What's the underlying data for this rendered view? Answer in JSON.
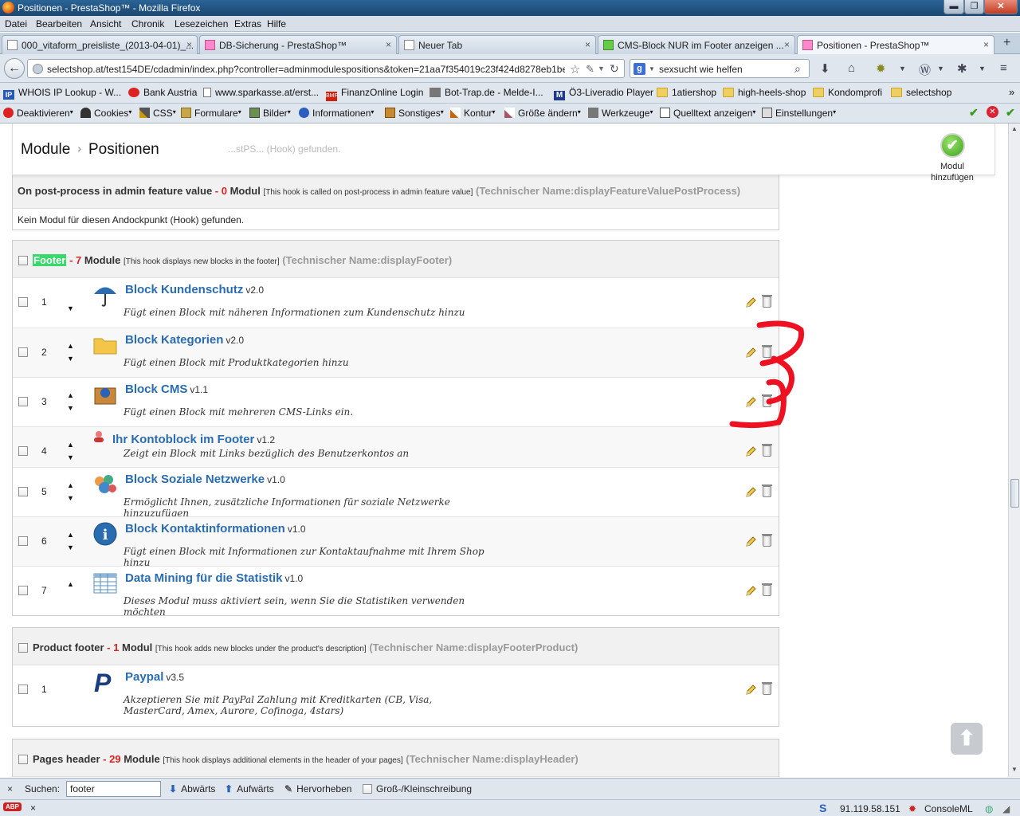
{
  "window": {
    "title": "Positionen - PrestaShop™ - Mozilla Firefox",
    "minimize": "▬",
    "maximize": "❐",
    "close": "✕"
  },
  "menu": [
    "Datei",
    "Bearbeiten",
    "Ansicht",
    "Chronik",
    "Lesezeichen",
    "Extras",
    "Hilfe"
  ],
  "tabs": [
    {
      "label": "000_vitaform_preisliste_(2013-04-01)_...",
      "close": "×"
    },
    {
      "label": "DB-Sicherung - PrestaShop™",
      "close": "×"
    },
    {
      "label": "Neuer Tab",
      "close": "×"
    },
    {
      "label": "CMS-Block NUR im Footer anzeigen ...",
      "close": "×"
    },
    {
      "label": "Positionen - PrestaShop™",
      "close": "×"
    }
  ],
  "new_tab": "+",
  "nav": {
    "url": "selectshop.at/test154DE/cdadmin/index.php?controller=adminmodulespositions&token=21aa7f354019c23f424d8278eb1be",
    "search_value": "sexsucht wie helfen",
    "back_icon": "←",
    "reload_icon": "↻",
    "star_icon": "☆",
    "search_engine_label": "g"
  },
  "bookmarks": [
    {
      "label": "WHOIS IP Lookup - W...",
      "icon": "ip-icon"
    },
    {
      "label": "Bank Austria",
      "icon": "no-entry-icon"
    },
    {
      "label": "www.sparkasse.at/erst...",
      "icon": "page-icon"
    },
    {
      "label": "FinanzOnline Login",
      "icon": "bmf-icon"
    },
    {
      "label": "Bot-Trap.de - Melde-I...",
      "icon": "bot-icon"
    },
    {
      "label": "Ö3-Liveradio Player",
      "icon": "m-icon"
    },
    {
      "label": "1atiershop",
      "icon": "folder-icon"
    },
    {
      "label": "high-heels-shop",
      "icon": "folder-icon"
    },
    {
      "label": "Kondomprofi",
      "icon": "folder-icon"
    },
    {
      "label": "selectshop",
      "icon": "folder-icon"
    }
  ],
  "bookmarks_more": "»",
  "devtools": [
    "Deaktivieren",
    "Cookies",
    "CSS",
    "Formulare",
    "Bilder",
    "Informationen",
    "Sonstiges",
    "Kontur",
    "Größe ändern",
    "Werkzeuge",
    "Quelltext anzeigen",
    "Einstellungen"
  ],
  "page": {
    "breadcrumb": [
      "Module",
      "Positionen"
    ],
    "breadcrumb_sep": "›",
    "ghost_text": "...stPS... (Hook) gefunden.",
    "add_module_label": "Modul hinzufügen",
    "add_module_icon": "✔"
  },
  "hooks": [
    {
      "title": "On post-process in admin feature value",
      "count_sep": " - ",
      "count": "0",
      "count_word": "Modul",
      "desc": "[This hook is called on post-process in admin feature value]",
      "tech": "(Technischer Name:displayFeatureValuePostProcess)",
      "empty": "Kein Modul für diesen Andockpunkt (Hook) gefunden."
    },
    {
      "title_hl": "Footer",
      "count_sep": " - ",
      "count": "7",
      "count_word": "Module",
      "desc": "[This hook displays new blocks in the footer]",
      "tech": "(Technischer Name:displayFooter)",
      "modules": [
        {
          "pos": "1",
          "name": "Block Kundenschutz",
          "ver": "v2.0",
          "desc": "Fügt einen Block mit näheren Informationen zum Kundenschutz hinzu",
          "icon": "umbrella-icon"
        },
        {
          "pos": "2",
          "name": "Block Kategorien",
          "ver": "v2.0",
          "desc": "Fügt einen Block mit Produktkategorien hinzu",
          "icon": "folder-icon"
        },
        {
          "pos": "3",
          "name": "Block CMS",
          "ver": "v1.1",
          "desc": "Fügt einen Block mit mehreren CMS-Links ein.",
          "icon": "box-icon"
        },
        {
          "pos": "4",
          "name": "Ihr Kontoblock im Footer",
          "ver": "v1.2",
          "desc": "Zeigt ein Block mit Links bezüglich des Benutzerkontos an",
          "icon": "user-icon"
        },
        {
          "pos": "5",
          "name": "Block Soziale Netzwerke",
          "ver": "v1.0",
          "desc": "Ermöglicht Ihnen, zusätzliche Informationen für soziale Netzwerke hinzuzufügen",
          "icon": "social-icon"
        },
        {
          "pos": "6",
          "name": "Block Kontaktinformationen",
          "ver": "v1.0",
          "desc": "Fügt einen Block mit Informationen zur Kontaktaufnahme mit Ihrem Shop hinzu",
          "icon": "info-icon"
        },
        {
          "pos": "7",
          "name": "Data Mining für die Statistik",
          "ver": "v1.0",
          "desc": "Dieses Modul muss aktiviert sein, wenn Sie die Statistiken verwenden möchten",
          "icon": "table-icon"
        }
      ]
    },
    {
      "title": "Product footer",
      "count_sep": " - ",
      "count": "1",
      "count_word": "Modul",
      "desc": "[This hook adds new blocks under the product's description]",
      "tech": "(Technischer Name:displayFooterProduct)",
      "modules": [
        {
          "pos": "1",
          "name": "Paypal",
          "ver": "v3.5",
          "desc": "Akzeptieren Sie mit PayPal Zahlung mit Kreditkarten (CB, Visa, MasterCard, Amex, Aurore, Cofinoga, 4stars)",
          "icon": "paypal-icon"
        }
      ]
    },
    {
      "title": "Pages header",
      "count_sep": " - ",
      "count": "29",
      "count_word": "Module",
      "desc": "[This hook displays additional elements in the header of your pages]",
      "tech": "(Technischer Name:displayHeader)"
    }
  ],
  "arrows": {
    "up": "▲",
    "down": "▼"
  },
  "scroll_top_icon": "⬆",
  "findbar": {
    "close": "×",
    "label": "Suchen:",
    "value": "footer",
    "down": "Abwärts",
    "up": "Aufwärts",
    "highlight": "Hervorheben",
    "case": "Groß-/Kleinschreibung"
  },
  "status": {
    "abp": "ABP",
    "close": "×",
    "ip": "91.119.58.151",
    "console": "ConsoleML"
  },
  "colors": {
    "link": "#2a6cb0",
    "count": "#dd2222",
    "highlight": "#38d96b",
    "annotation": "#ee1122"
  }
}
